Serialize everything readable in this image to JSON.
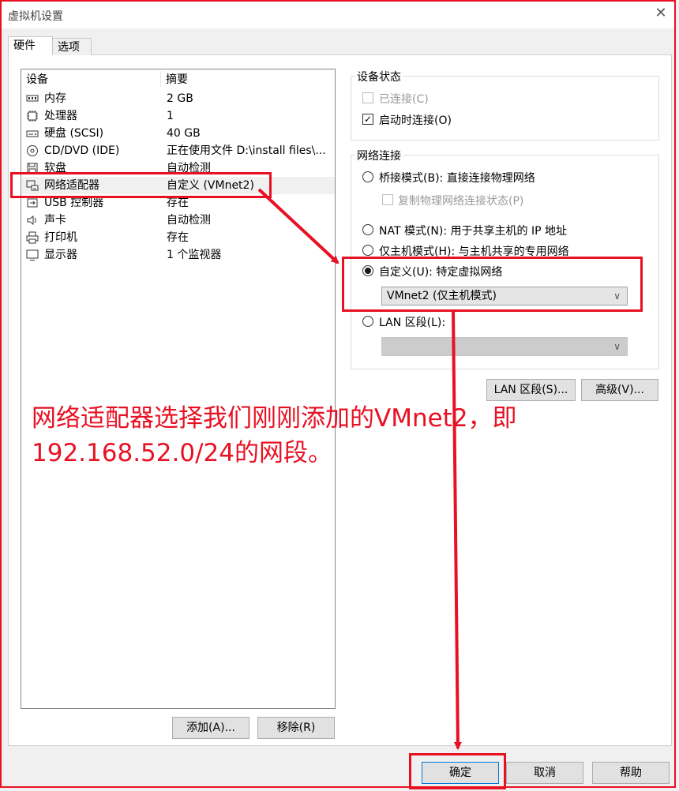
{
  "window": {
    "title": "虚拟机设置"
  },
  "tabs": [
    {
      "label": "硬件",
      "active": true
    },
    {
      "label": "选项",
      "active": false
    }
  ],
  "device_list": {
    "headers": {
      "device": "设备",
      "summary": "摘要"
    },
    "rows": [
      {
        "icon": "memory-icon",
        "name": "内存",
        "summary": "2 GB"
      },
      {
        "icon": "cpu-icon",
        "name": "处理器",
        "summary": "1"
      },
      {
        "icon": "harddisk-icon",
        "name": "硬盘 (SCSI)",
        "summary": "40 GB"
      },
      {
        "icon": "cdrom-icon",
        "name": "CD/DVD (IDE)",
        "summary": "正在使用文件 D:\\install files\\..."
      },
      {
        "icon": "floppy-icon",
        "name": "软盘",
        "summary": "自动检测"
      },
      {
        "icon": "network-adapter-icon",
        "name": "网络适配器",
        "summary": "自定义 (VMnet2)",
        "selected": true
      },
      {
        "icon": "usb-icon",
        "name": "USB 控制器",
        "summary": "存在"
      },
      {
        "icon": "sound-icon",
        "name": "声卡",
        "summary": "自动检测"
      },
      {
        "icon": "printer-icon",
        "name": "打印机",
        "summary": "存在"
      },
      {
        "icon": "display-icon",
        "name": "显示器",
        "summary": "1 个监视器"
      }
    ]
  },
  "device_buttons": {
    "add": "添加(A)...",
    "remove": "移除(R)"
  },
  "device_status": {
    "title": "设备状态",
    "connected": {
      "label": "已连接(C)",
      "checked": false,
      "disabled": true
    },
    "connect_on_power": {
      "label": "启动时连接(O)",
      "checked": true
    }
  },
  "network_connection": {
    "title": "网络连接",
    "bridged": {
      "label": "桥接模式(B): 直接连接物理网络",
      "selected": false
    },
    "replicate": {
      "label": "复制物理网络连接状态(P)",
      "checked": false,
      "disabled": true
    },
    "nat": {
      "label": "NAT 模式(N): 用于共享主机的 IP 地址",
      "selected": false
    },
    "host_only": {
      "label": "仅主机模式(H): 与主机共享的专用网络",
      "selected": false
    },
    "custom": {
      "label": "自定义(U): 特定虚拟网络",
      "selected": true
    },
    "custom_select": {
      "value": "VMnet2 (仅主机模式)"
    },
    "lan_segment": {
      "label": "LAN 区段(L):",
      "selected": false
    },
    "lan_select": {
      "value": ""
    }
  },
  "advanced_buttons": {
    "lan_segments": "LAN 区段(S)...",
    "advanced": "高级(V)..."
  },
  "dialog_buttons": {
    "ok": "确定",
    "cancel": "取消",
    "help": "帮助"
  },
  "annotation": {
    "line1": "网络适配器选择我们刚刚添加的VMnet2，即",
    "line2": "192.168.52.0/24的网段。",
    "color": "#e81123"
  }
}
